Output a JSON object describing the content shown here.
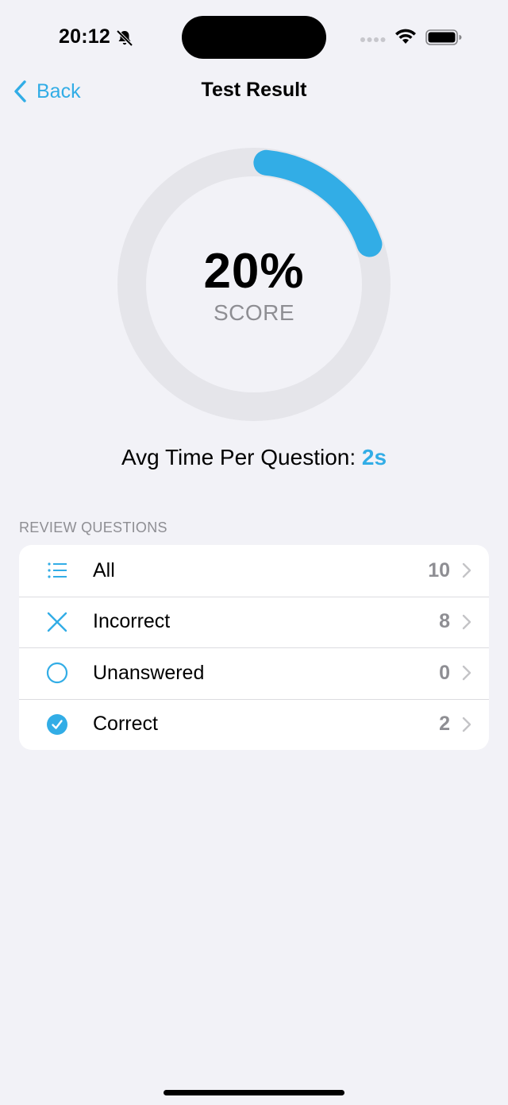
{
  "status_bar": {
    "time": "20:12",
    "icons": [
      "bell-slash-icon",
      "cellular-signal-icon",
      "wifi-icon",
      "battery-icon"
    ]
  },
  "nav": {
    "back_label": "Back",
    "title": "Test Result"
  },
  "score": {
    "value": "20%",
    "label": "SCORE",
    "fraction": 0.2
  },
  "avg_time": {
    "label": "Avg Time Per Question:",
    "value": "2s"
  },
  "review": {
    "header": "REVIEW QUESTIONS",
    "items": [
      {
        "icon": "list-icon",
        "label": "All",
        "count": "10"
      },
      {
        "icon": "x-mark-icon",
        "label": "Incorrect",
        "count": "8"
      },
      {
        "icon": "circle-icon",
        "label": "Unanswered",
        "count": "0"
      },
      {
        "icon": "checkmark-circle-icon",
        "label": "Correct",
        "count": "2"
      }
    ]
  },
  "colors": {
    "accent": "#32ade6",
    "track": "#e5e5ea",
    "background": "#f2f2f7",
    "secondary_text": "#8e8e93"
  }
}
